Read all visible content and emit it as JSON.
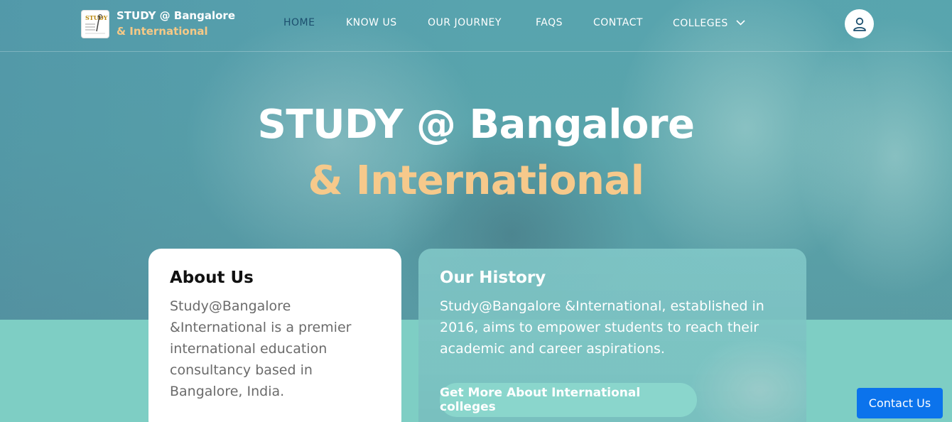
{
  "brand": {
    "line1": "STUDY @ Bangalore",
    "line2": "& International",
    "logo_icon": "study-logo-icon"
  },
  "nav": {
    "items": [
      {
        "label": "HOME",
        "active": true
      },
      {
        "label": "KNOW US",
        "active": false
      },
      {
        "label": "OUR JOURNEY",
        "active": false
      },
      {
        "label": "FAQS",
        "active": false
      },
      {
        "label": "CONTACT",
        "active": false
      },
      {
        "label": "COLLEGES",
        "active": false,
        "icon": "chevron-down-icon"
      }
    ],
    "user_icon": "user-icon"
  },
  "hero": {
    "title_line1": "STUDY @ Bangalore",
    "title_line2": "& International"
  },
  "about": {
    "heading": "About Us",
    "body": "Study@Bangalore &International is a premier international education consultancy based in Bangalore, India."
  },
  "history": {
    "heading": "Our History",
    "body": "Study@Bangalore &International, established in 2016, aims to empower students to reach their academic and career aspirations.",
    "button_label": "Get More About International colleges"
  },
  "contact_button": {
    "label": "Contact Us"
  },
  "colors": {
    "accent_gold": "#f6c98b",
    "active_nav": "#1c4f6e",
    "contact_blue": "#0b73ec",
    "teal_band": "#7ecec4"
  }
}
